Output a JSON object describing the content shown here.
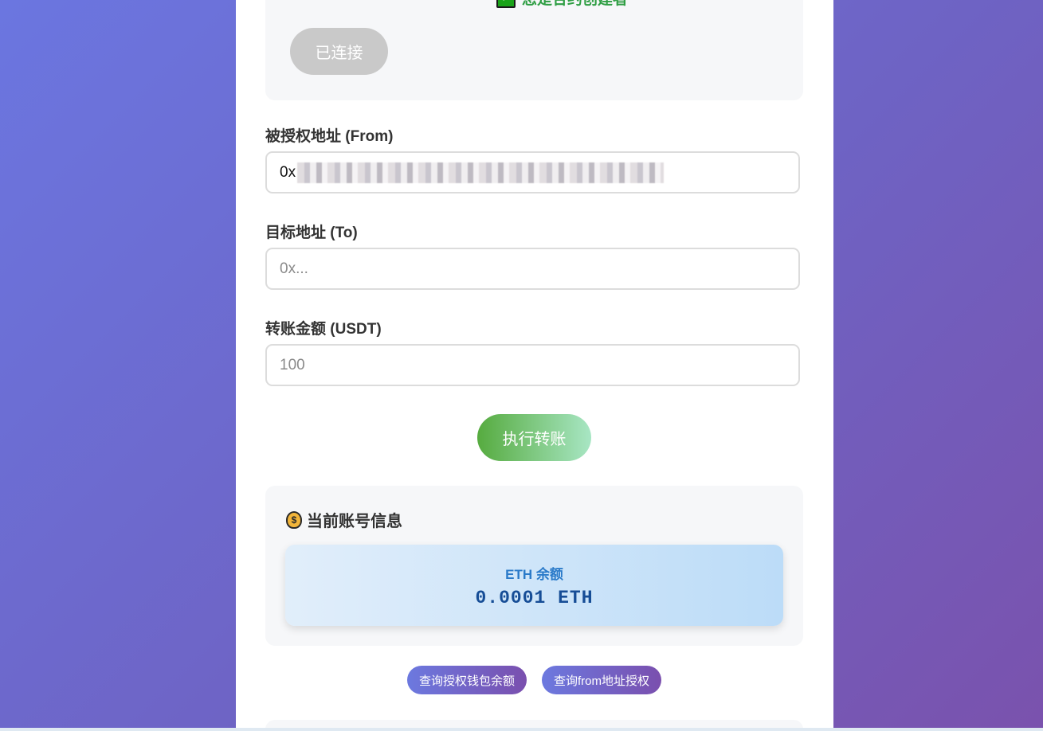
{
  "status": {
    "creator_text": "您是合约创建者",
    "check_icon": "check-mark-icon",
    "connected_label": "已连接"
  },
  "form": {
    "from_label": "被授权地址 (From)",
    "from_value_visible_prefix": "0x",
    "to_label": "目标地址 (To)",
    "to_placeholder": "0x...",
    "amount_label": "转账金额 (USDT)",
    "amount_placeholder": "100",
    "execute_label": "执行转账"
  },
  "account_info": {
    "icon": "money-bag-icon",
    "title": "当前账号信息",
    "eth_label": "ETH 余额",
    "eth_value": "0.0001 ETH"
  },
  "actions": {
    "query_balance_label": "查询授权钱包余额",
    "query_allowance_label": "查询from地址授权"
  },
  "colors": {
    "accent_green": "#2f9e44",
    "button_gradient_start": "#6c79df",
    "button_gradient_end": "#7a4fae"
  }
}
